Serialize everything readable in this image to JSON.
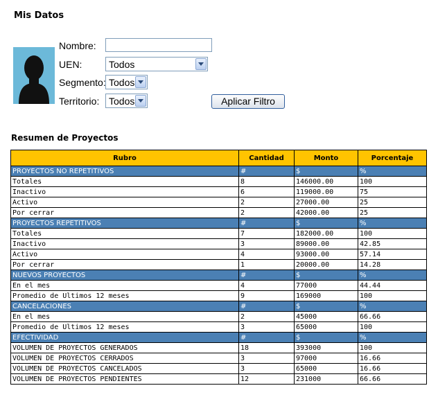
{
  "header": {
    "title": "Mis Datos"
  },
  "filters": {
    "nombre_label": "Nombre:",
    "nombre_value": "",
    "uen_label": "UEN:",
    "uen_value": "Todos",
    "segmento_label": "Segmento:",
    "segmento_value": "Todos",
    "territorio_label": "Territorio:",
    "territorio_value": "Todos",
    "apply_label": "Aplicar Filtro"
  },
  "summary": {
    "title": "Resumen de Proyectos",
    "columns": [
      "Rubro",
      "Cantidad",
      "Monto",
      "Porcentaje"
    ],
    "sections": [
      {
        "name": "PROYECTOS NO REPETITIVOS",
        "marks": [
          "#",
          "$",
          "%"
        ],
        "rows": [
          [
            "Totales",
            "8",
            "146000.00",
            "100"
          ],
          [
            "Inactivo",
            "6",
            "119000.00",
            "75"
          ],
          [
            "Activo",
            "2",
            "27000.00",
            "25"
          ],
          [
            "Por cerrar",
            "2",
            "42000.00",
            "25"
          ]
        ]
      },
      {
        "name": "PROYECTOS REPETITIVOS",
        "marks": [
          "#",
          "$",
          "%"
        ],
        "rows": [
          [
            "Totales",
            "7",
            "182000.00",
            "100"
          ],
          [
            "Inactivo",
            "3",
            "89000.00",
            "42.85"
          ],
          [
            "Activo",
            "4",
            "93000.00",
            "57.14"
          ],
          [
            "Por cerrar",
            "1",
            "20000.00",
            "14.28"
          ]
        ]
      },
      {
        "name": "NUEVOS PROYECTOS",
        "marks": [
          "#",
          "$",
          "%"
        ],
        "rows": [
          [
            "En el mes",
            "4",
            "77000",
            "44.44"
          ],
          [
            "Promedio de Ultimos 12 meses",
            "9",
            "169000",
            "100"
          ]
        ]
      },
      {
        "name": "CANCELACIONES",
        "marks": [
          "#",
          "$",
          "%"
        ],
        "rows": [
          [
            "En el mes",
            "2",
            "45000",
            "66.66"
          ],
          [
            "Promedio de Ultimos 12 meses",
            "3",
            "65000",
            "100"
          ]
        ]
      },
      {
        "name": "EFECTIVIDAD",
        "marks": [
          "#",
          "$",
          "%"
        ],
        "rows": [
          [
            "VOLUMEN DE PROYECTOS GENERADOS",
            "18",
            "393000",
            "100"
          ],
          [
            "VOLUMEN DE PROYECTOS CERRADOS",
            "3",
            "97000",
            "16.66"
          ],
          [
            "VOLUMEN DE PROYECTOS CANCELADOS",
            "3",
            "65000",
            "16.66"
          ],
          [
            "VOLUMEN DE PROYECTOS PENDIENTES",
            "12",
            "231000",
            "66.66"
          ]
        ]
      }
    ]
  },
  "colors": {
    "header_bg": "#ffc400",
    "section_bg": "#4b80b4",
    "avatar_bg": "#6cb9d9"
  },
  "icons": {
    "avatar": "user-silhouette-icon",
    "dropdown": "chevron-down-icon"
  }
}
